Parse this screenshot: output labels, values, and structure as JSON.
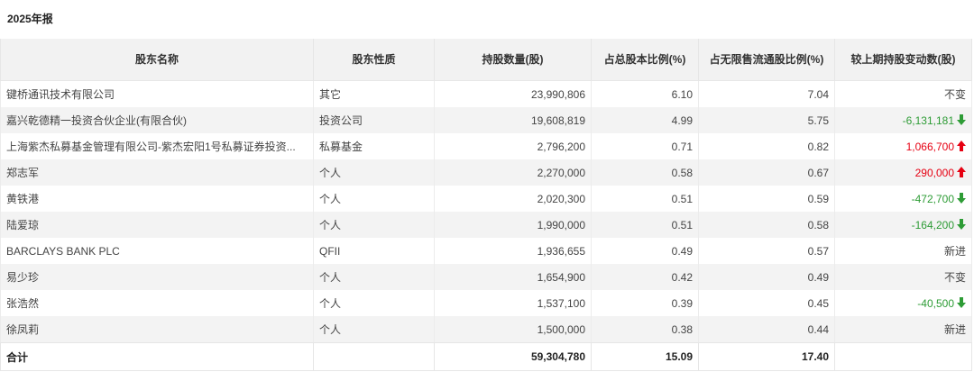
{
  "section_title": "2025年报",
  "columns": [
    "股东名称",
    "股东性质",
    "持股数量(股)",
    "占总股本比例(%)",
    "占无限售流通股比例(%)",
    "较上期持股变动数(股)"
  ],
  "rows": [
    {
      "name": "键桥通讯技术有限公司",
      "type": "其它",
      "shares": "23,990,806",
      "pct_total": "6.10",
      "pct_float": "7.04",
      "change": "不变",
      "dir": "flat"
    },
    {
      "name": "嘉兴乾德精一投资合伙企业(有限合伙)",
      "type": "投资公司",
      "shares": "19,608,819",
      "pct_total": "4.99",
      "pct_float": "5.75",
      "change": "-6,131,181",
      "dir": "down"
    },
    {
      "name": "上海紫杰私募基金管理有限公司-紫杰宏阳1号私募证券投资...",
      "type": "私募基金",
      "shares": "2,796,200",
      "pct_total": "0.71",
      "pct_float": "0.82",
      "change": "1,066,700",
      "dir": "up"
    },
    {
      "name": "郑志军",
      "type": "个人",
      "shares": "2,270,000",
      "pct_total": "0.58",
      "pct_float": "0.67",
      "change": "290,000",
      "dir": "up"
    },
    {
      "name": "黄铁港",
      "type": "个人",
      "shares": "2,020,300",
      "pct_total": "0.51",
      "pct_float": "0.59",
      "change": "-472,700",
      "dir": "down"
    },
    {
      "name": "陆爱琼",
      "type": "个人",
      "shares": "1,990,000",
      "pct_total": "0.51",
      "pct_float": "0.58",
      "change": "-164,200",
      "dir": "down"
    },
    {
      "name": "BARCLAYS BANK PLC",
      "type": "QFII",
      "shares": "1,936,655",
      "pct_total": "0.49",
      "pct_float": "0.57",
      "change": "新进",
      "dir": "flat"
    },
    {
      "name": "易少珍",
      "type": "个人",
      "shares": "1,654,900",
      "pct_total": "0.42",
      "pct_float": "0.49",
      "change": "不变",
      "dir": "flat"
    },
    {
      "name": "张浩然",
      "type": "个人",
      "shares": "1,537,100",
      "pct_total": "0.39",
      "pct_float": "0.45",
      "change": "-40,500",
      "dir": "down"
    },
    {
      "name": "徐凤莉",
      "type": "个人",
      "shares": "1,500,000",
      "pct_total": "0.38",
      "pct_float": "0.44",
      "change": "新进",
      "dir": "flat"
    }
  ],
  "total": {
    "label": "合计",
    "shares": "59,304,780",
    "pct_total": "15.09",
    "pct_float": "17.40"
  },
  "colors": {
    "up": "#e60012",
    "down": "#2e9c36",
    "header_bg": "#f2f2f2",
    "stripe_bg": "#f3f3f3",
    "corner": "#f5632a"
  },
  "icons": {
    "up": "arrow-up-icon",
    "down": "arrow-down-icon"
  }
}
